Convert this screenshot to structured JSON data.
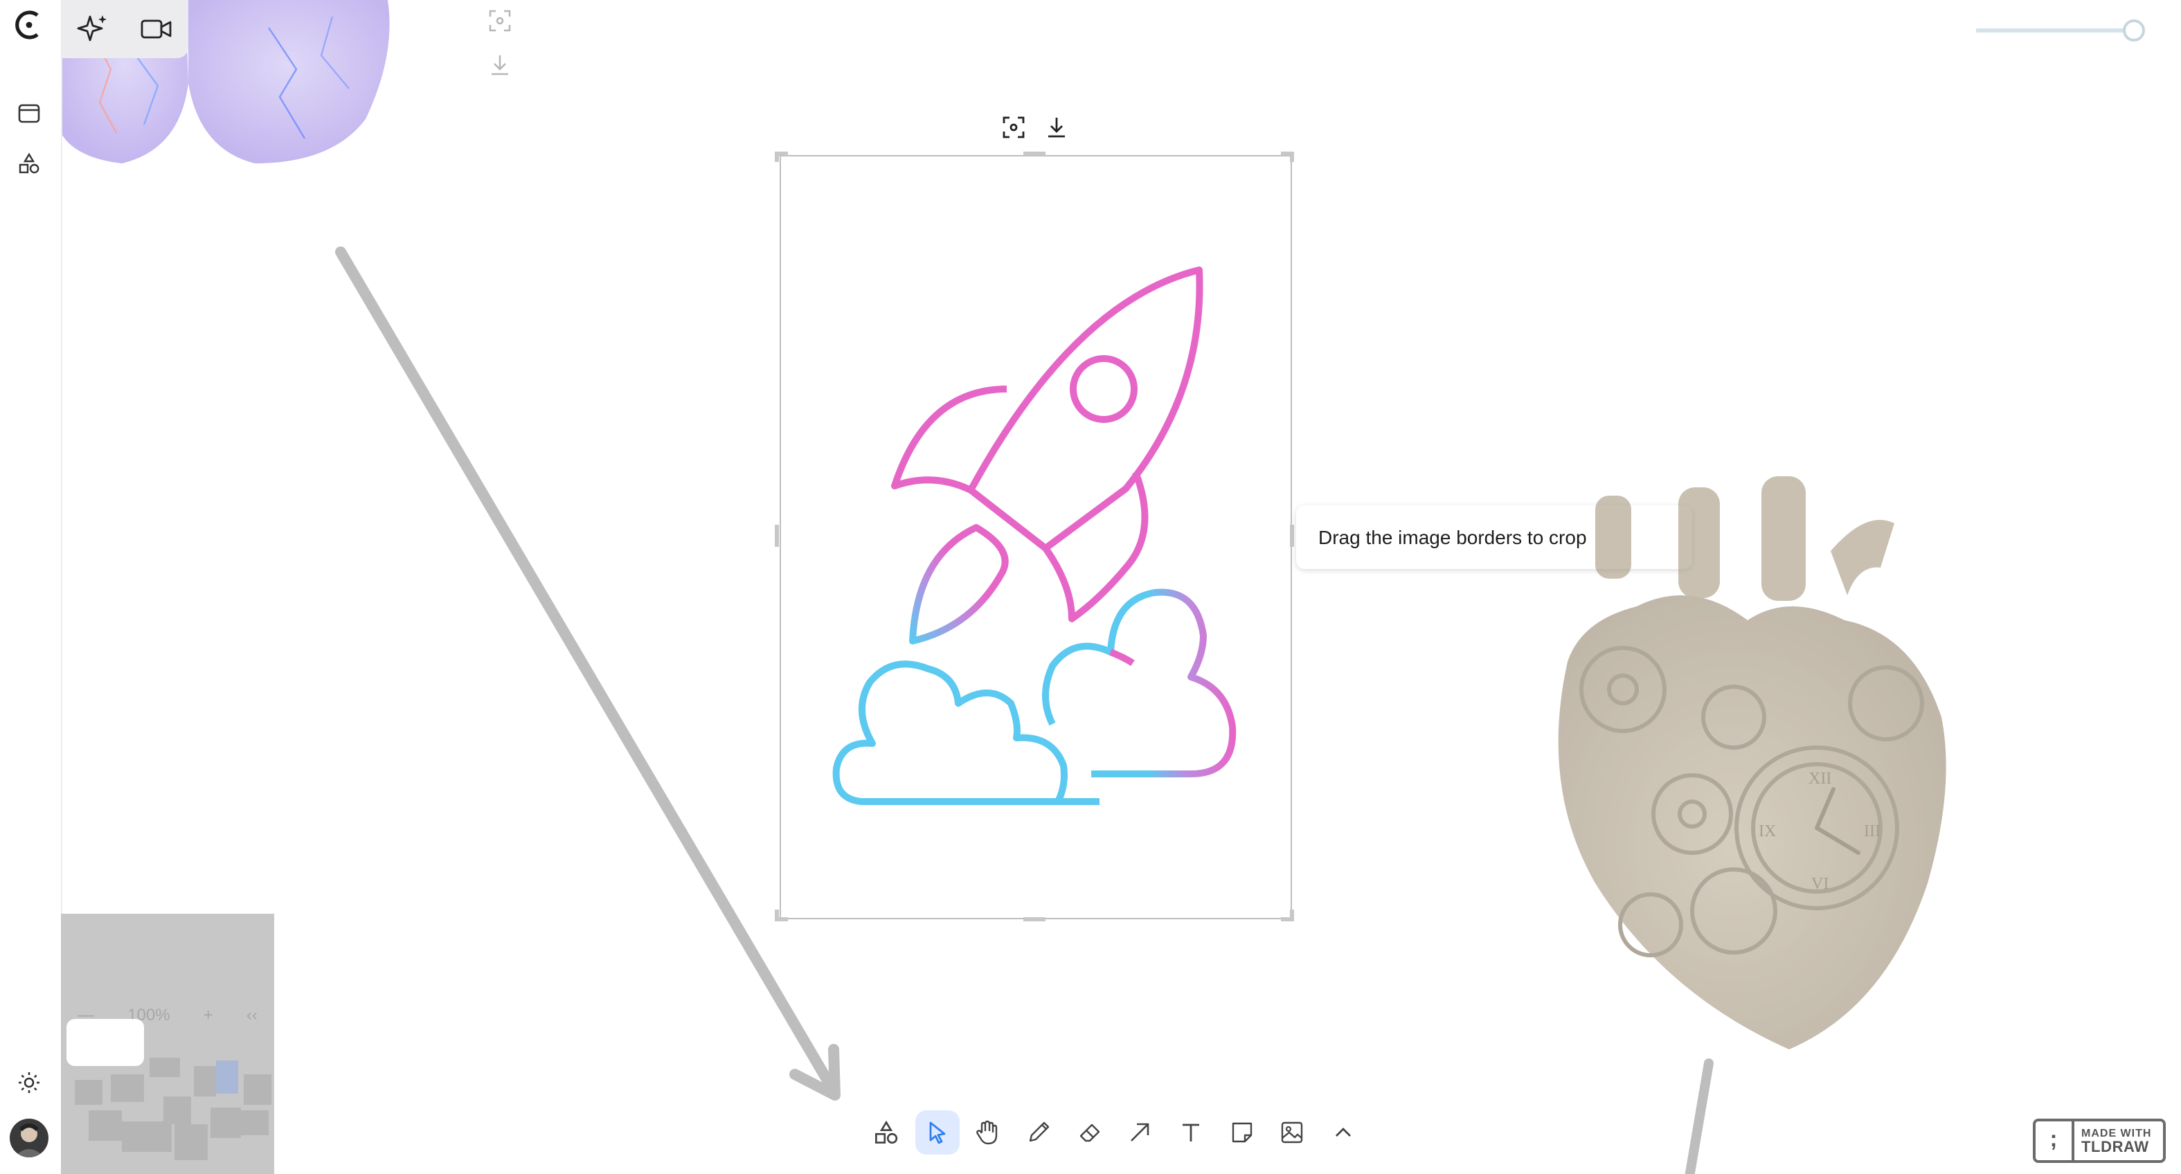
{
  "app": {
    "name": "tldraw"
  },
  "tooltip": {
    "text": "Drag the image borders to crop"
  },
  "minimap": {
    "zoom_out": "—",
    "zoom_level": "100%",
    "zoom_in": "+",
    "collapse": "‹‹"
  },
  "watermark": {
    "line1": "MADE WITH",
    "line2": "TLDRAW",
    "glyph": ";"
  },
  "toolbar": {
    "tools": [
      {
        "id": "shapes",
        "icon": "shapes-icon"
      },
      {
        "id": "select",
        "icon": "cursor-icon",
        "active": true
      },
      {
        "id": "hand",
        "icon": "hand-icon"
      },
      {
        "id": "draw",
        "icon": "pencil-icon"
      },
      {
        "id": "eraser",
        "icon": "eraser-icon"
      },
      {
        "id": "arrow",
        "icon": "arrow-icon"
      },
      {
        "id": "text",
        "icon": "text-icon",
        "glyph": "T"
      },
      {
        "id": "note",
        "icon": "note-icon"
      },
      {
        "id": "image",
        "icon": "image-icon"
      },
      {
        "id": "more",
        "icon": "chevron-up-icon"
      }
    ]
  },
  "colors": {
    "accent": "#2f80ed",
    "active_tool_bg": "#dfe9ff",
    "rocket_pink": "#e666c8",
    "cloud_blue": "#5cc9f0",
    "arrow_gray": "#bdbdbd"
  }
}
